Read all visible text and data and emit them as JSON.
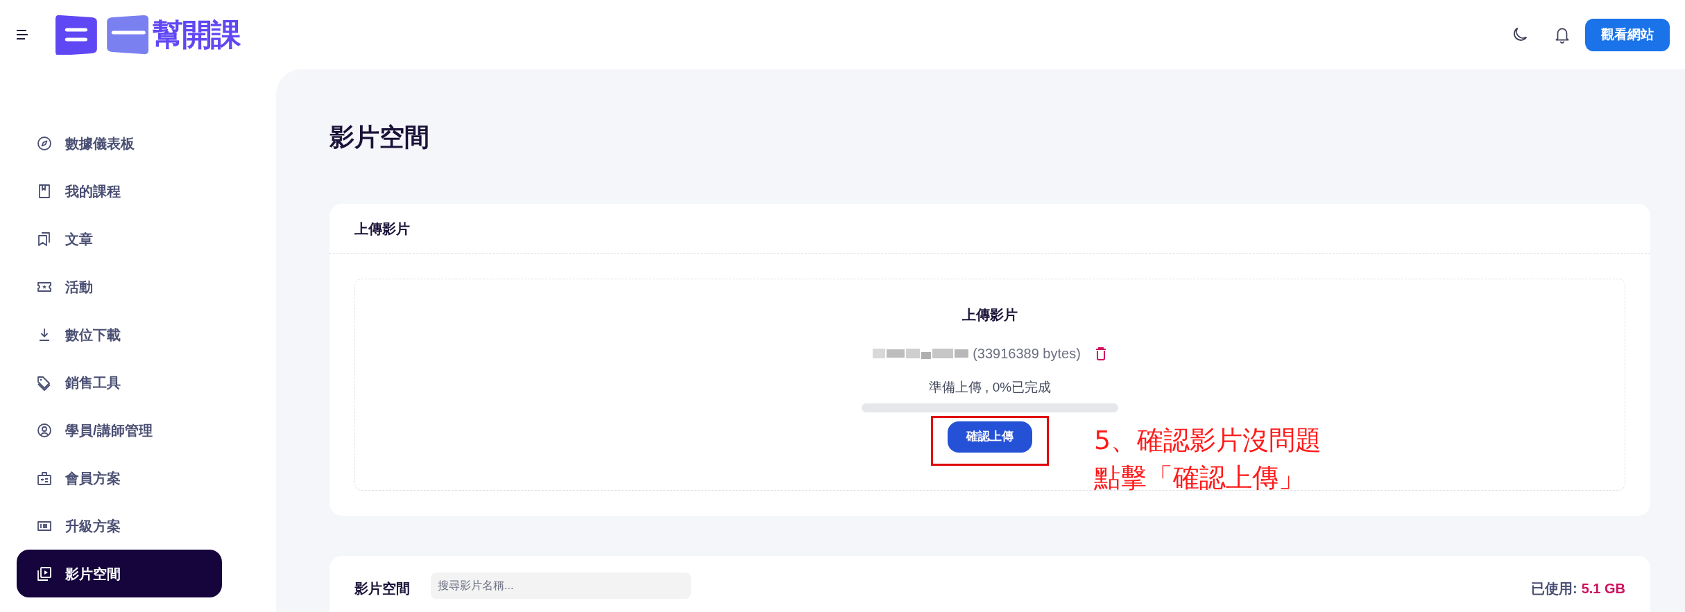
{
  "header": {
    "logo_text": "幫開課",
    "site_button": "觀看網站"
  },
  "sidebar": {
    "items": [
      {
        "label": "數據儀表板",
        "selected": false
      },
      {
        "label": "我的課程",
        "selected": false
      },
      {
        "label": "文章",
        "selected": false
      },
      {
        "label": "活動",
        "selected": false
      },
      {
        "label": "數位下載",
        "selected": false
      },
      {
        "label": "銷售工具",
        "selected": false
      },
      {
        "label": "學員/講師管理",
        "selected": false
      },
      {
        "label": "會員方案",
        "selected": false
      },
      {
        "label": "升級方案",
        "selected": false
      },
      {
        "label": "影片空間",
        "selected": true
      }
    ]
  },
  "page_title": "影片空間",
  "upload_card": {
    "title": "上傳影片",
    "dropzone": {
      "title": "上傳影片",
      "file_size": "(33916389 bytes)",
      "status": "準備上傳 , 0%已完成",
      "level": 0,
      "button": "確認上傳"
    }
  },
  "annotation": {
    "lines": [
      "5、確認影片沒問題",
      "點擊「確認上傳」"
    ]
  },
  "library_card": {
    "title": "影片空間",
    "search": {
      "placeholder": "搜尋影片名稱..."
    },
    "usage_label": "已使用:",
    "usage_value": "5.1 GB"
  }
}
